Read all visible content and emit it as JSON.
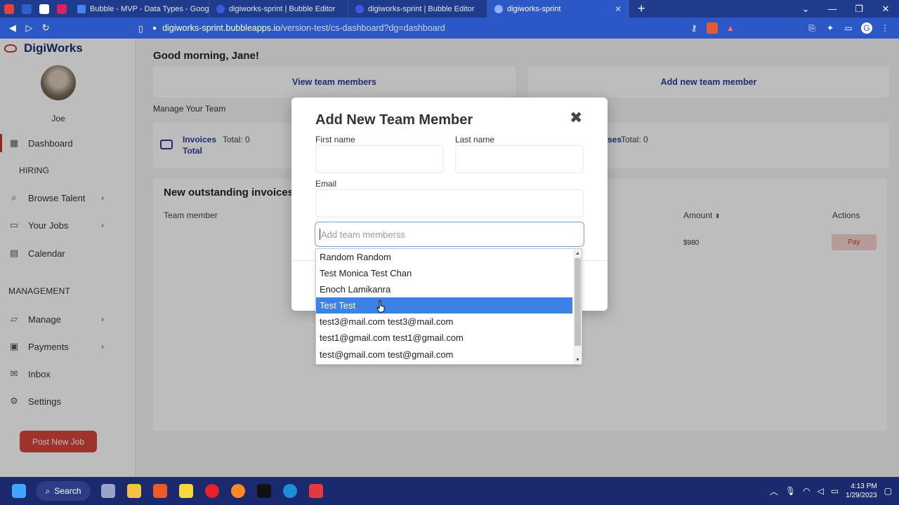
{
  "browser": {
    "tabs": [
      {
        "title": "Bubble - MVP - Data Types - Google D",
        "color": "#1a73e8"
      },
      {
        "title": "digiworks-sprint | Bubble Editor",
        "color": "#3b5bdb"
      },
      {
        "title": "digiworks-sprint | Bubble Editor",
        "color": "#3b5bdb"
      },
      {
        "title": "digiworks-sprint",
        "color": "#3b5bdb"
      }
    ],
    "new_tab": "+",
    "url_host": "digiworks-sprint.bubbleapps.io",
    "url_path": "/version-test/cs-dashboard?dg=dashboard"
  },
  "sidebar": {
    "brand": "DigiWorks",
    "user_name": "Joe",
    "dashboard": "Dashboard",
    "hiring_section": "HIRING",
    "browse_talent": "Browse Talent",
    "your_jobs": "Your Jobs",
    "calendar": "Calendar",
    "management_section": "MANAGEMENT",
    "manage": "Manage",
    "payments": "Payments",
    "inbox": "Inbox",
    "settings": "Settings",
    "post_job": "Post New Job"
  },
  "main": {
    "greeting": "Good morning, Jane!",
    "view_team": "View team members",
    "add_member": "Add new team member",
    "manage_team": "Manage Your Team",
    "invoices_stat": {
      "title": "Invoices",
      "total": "Total: 0",
      "sub": "Total"
    },
    "expenses_stat": {
      "title": "ses",
      "total": "Total: 0"
    },
    "invoices_title": "New outstanding invoices: 1",
    "col_team_member": "Team member",
    "col_amount": "Amount",
    "col_actions": "Actions",
    "amount_value": "$980",
    "pay_label": "Pay"
  },
  "modal": {
    "title": "Add New Team Member",
    "close": "✖",
    "first_name_label": "First name",
    "last_name_label": "Last name",
    "email_label": "Email",
    "team_placeholder": "Add team memberss"
  },
  "dropdown": {
    "options": [
      "Random Random",
      "Test Monica Test Chan",
      "Enoch Lamikanra",
      "Test Test",
      "test3@mail.com test3@mail.com",
      "test1@gmail.com test1@gmail.com",
      "test@gmail.com test@gmail.com"
    ],
    "selected": "Test Test",
    "highlight_color": "#3d80e6"
  },
  "taskbar": {
    "search": "Search",
    "time": "4:13 PM",
    "date": "1/29/2023"
  },
  "colors": {
    "brand_navy": "#1c2c6b",
    "accent_red": "#d4453a",
    "link_blue": "#2b3c9a"
  }
}
